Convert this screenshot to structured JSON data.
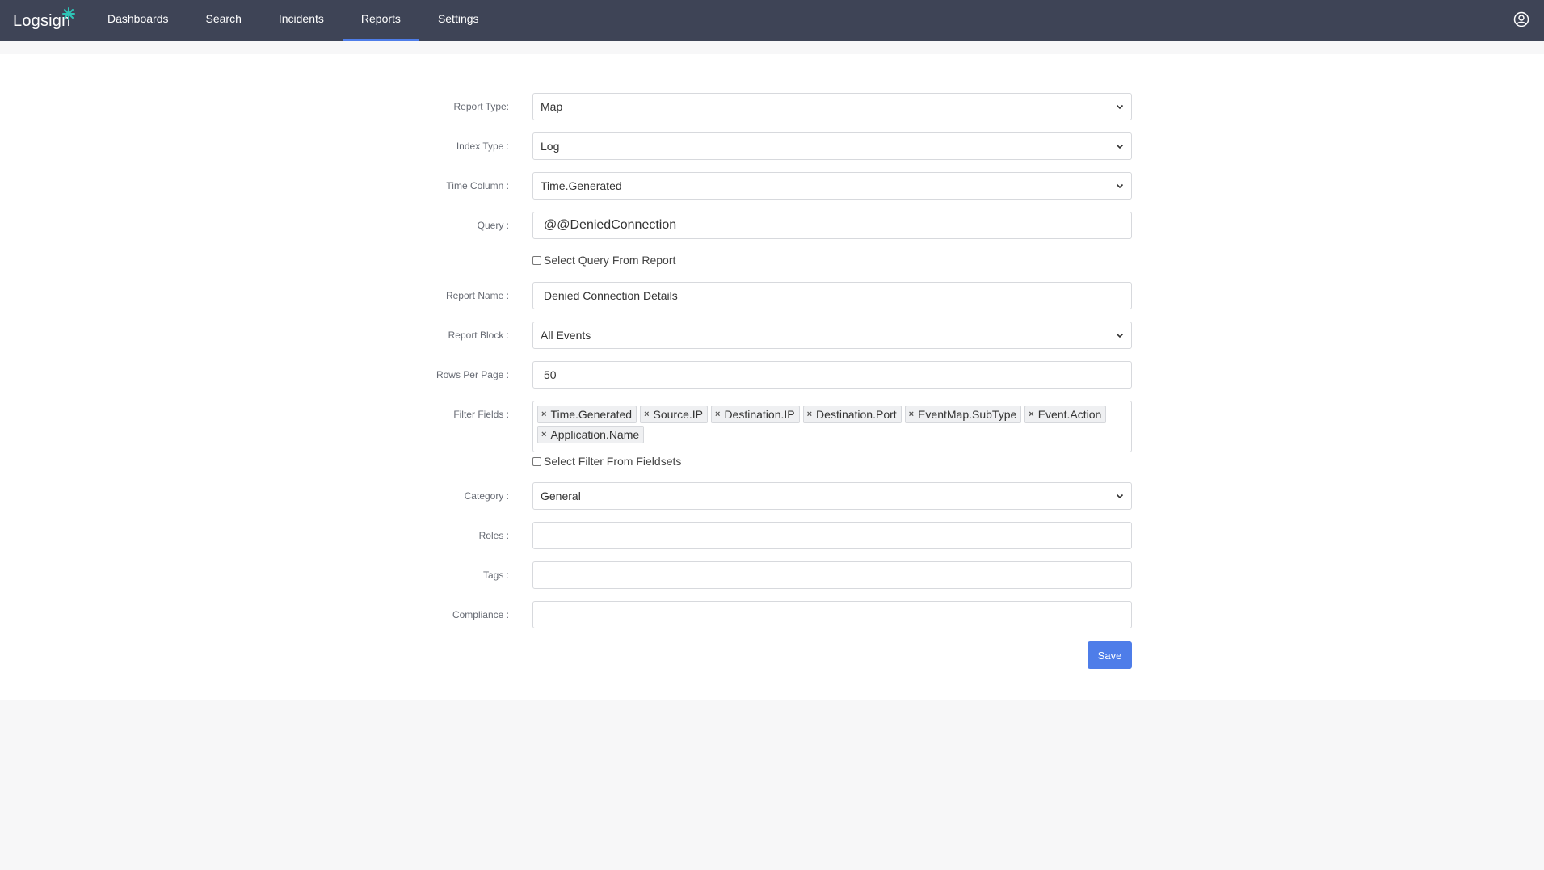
{
  "app": {
    "logo_text": "Logsign",
    "nav": [
      {
        "label": "Dashboards"
      },
      {
        "label": "Search"
      },
      {
        "label": "Incidents"
      },
      {
        "label": "Reports"
      },
      {
        "label": "Settings"
      }
    ],
    "active_tab": "Reports",
    "accent_color": "#4e7de9",
    "topbar_color": "#3e4456"
  },
  "form": {
    "report_type": {
      "label": "Report Type:",
      "value": "Map"
    },
    "index_type": {
      "label": "Index Type :",
      "value": "Log"
    },
    "time_column": {
      "label": "Time Column :",
      "value": "Time.Generated"
    },
    "query": {
      "label": "Query :",
      "value": "@@DeniedConnection"
    },
    "select_query_from_report": {
      "label": "Select Query From Report",
      "checked": false
    },
    "report_name": {
      "label": "Report Name :",
      "value": "Denied Connection Details"
    },
    "report_block": {
      "label": "Report Block :",
      "value": "All Events"
    },
    "rows_per_page": {
      "label": "Rows Per Page :",
      "value": "50"
    },
    "filter_fields": {
      "label": "Filter Fields :",
      "tags": [
        "Time.Generated",
        "Source.IP",
        "Destination.IP",
        "Destination.Port",
        "EventMap.SubType",
        "Event.Action",
        "Application.Name"
      ],
      "remove_glyph": "×"
    },
    "select_filter_from_fieldsets": {
      "label": "Select Filter From Fieldsets",
      "checked": false
    },
    "category": {
      "label": "Category :",
      "value": "General"
    },
    "roles": {
      "label": "Roles :",
      "value": ""
    },
    "tags": {
      "label": "Tags :",
      "value": ""
    },
    "compliance": {
      "label": "Compliance :",
      "value": ""
    },
    "save_label": "Save"
  }
}
